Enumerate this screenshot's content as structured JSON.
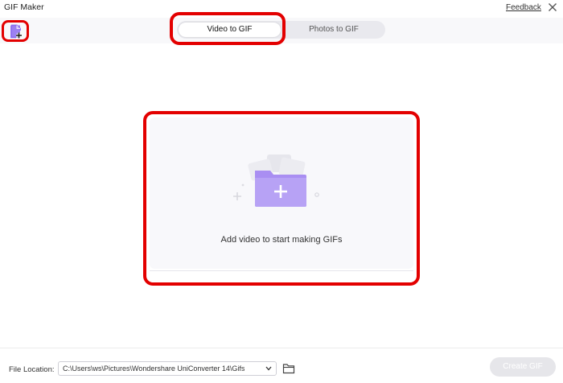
{
  "window": {
    "title": "GIF Maker",
    "feedback_label": "Feedback"
  },
  "tabs": [
    {
      "label": "Video to GIF",
      "active": true
    },
    {
      "label": "Photos to GIF",
      "active": false
    }
  ],
  "drop_zone": {
    "text": "Add video to start making GIFs"
  },
  "footer": {
    "file_location_label": "File Location:",
    "path": "C:\\Users\\ws\\Pictures\\Wondershare UniConverter 14\\Gifs",
    "create_label": "Create GIF"
  },
  "colors": {
    "accent": "#9b7cf0",
    "highlight": "#e30000",
    "folder_light": "#b7a2f5",
    "folder_dark": "#9a80ef"
  },
  "icons": [
    "add-file-icon",
    "close-icon",
    "folder-plus-icon",
    "chevron-down-icon",
    "folder-open-icon"
  ]
}
